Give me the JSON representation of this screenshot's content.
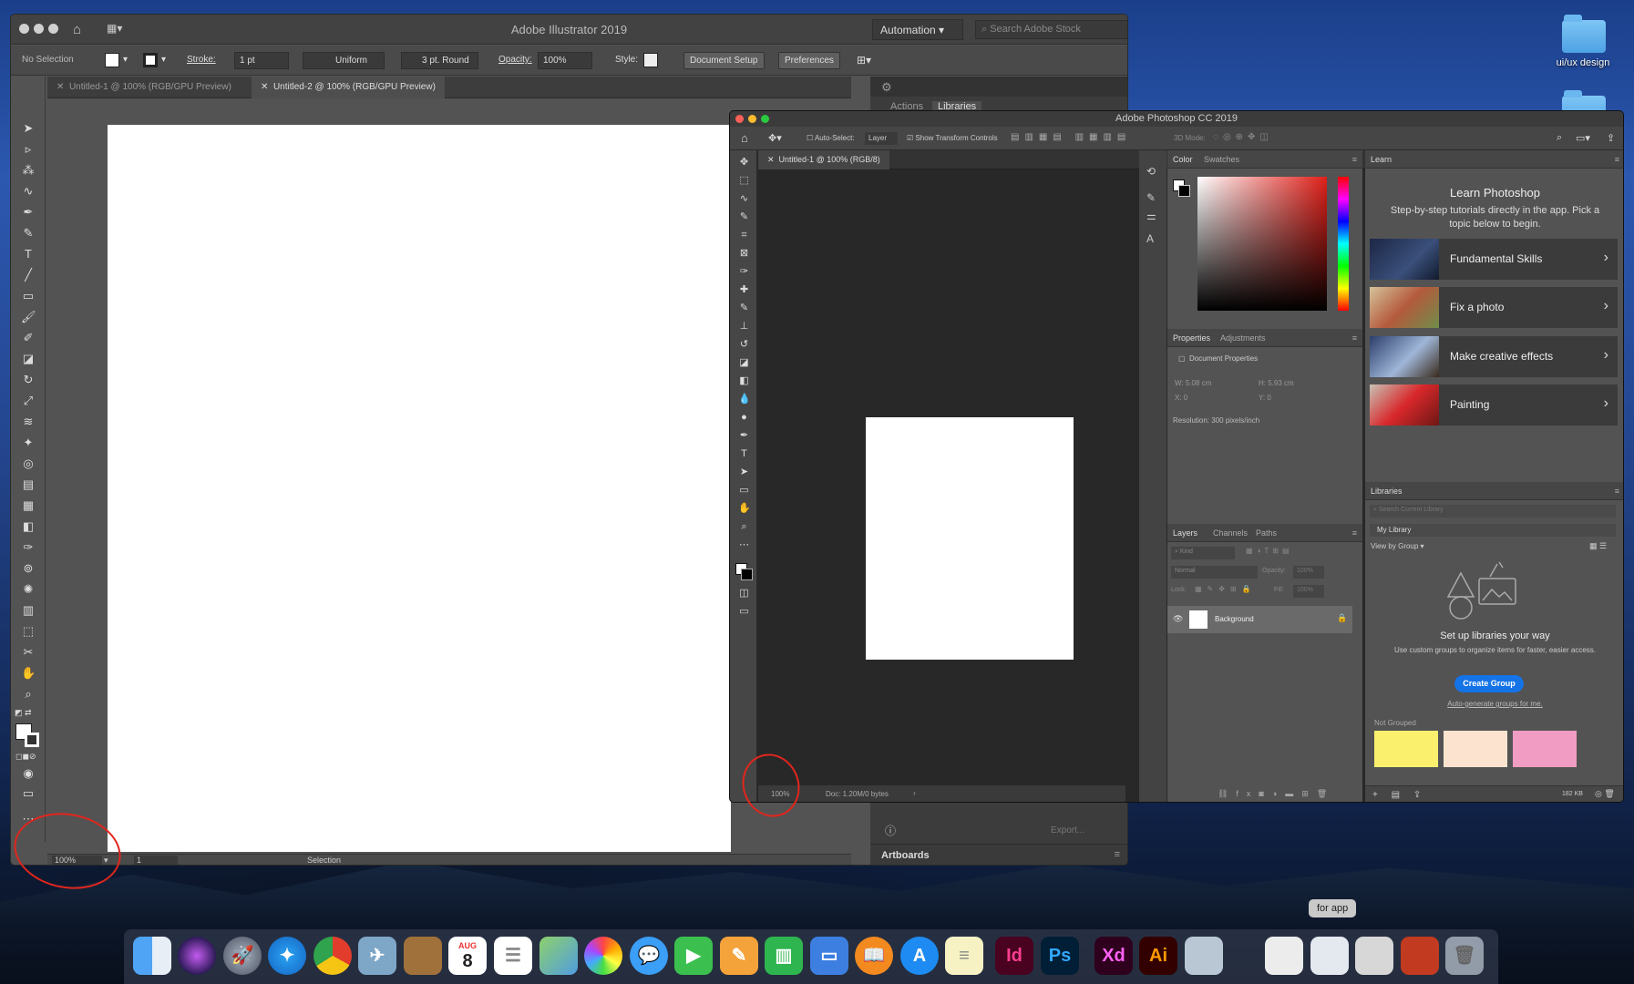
{
  "desktop": {
    "folder_label": "ui/ux design",
    "tooltip": "for app"
  },
  "illustrator": {
    "title": "Adobe Illustrator 2019",
    "workspace": "Automation",
    "search_placeholder": "Search Adobe Stock",
    "selection_text": "No Selection",
    "stroke_label": "Stroke:",
    "stroke_value": "1 pt",
    "profile": "Uniform",
    "brush": "3 pt. Round",
    "opacity_label": "Opacity:",
    "opacity_value": "100%",
    "style_label": "Style:",
    "document_setup": "Document Setup",
    "preferences": "Preferences",
    "tabs": [
      "Untitled-1 @ 100% (RGB/GPU Preview)",
      "Untitled-2 @ 100% (RGB/GPU Preview)"
    ],
    "zoom": "100%",
    "artboard_num": "1",
    "status_tool": "Selection",
    "panel_tabs": [
      "Actions",
      "Libraries"
    ],
    "export_label": "Export...",
    "artboards_label": "Artboards"
  },
  "photoshop": {
    "title": "Adobe Photoshop CC 2019",
    "auto_select": "Auto-Select:",
    "layer_select": "Layer",
    "transform": "Show Transform Controls",
    "mode3d": "3D Mode:",
    "doc_tab": "Untitled-1 @ 100% (RGB/8)",
    "zoom": "100%",
    "doc_size": "Doc: 1.20M/0 bytes",
    "color_tabs": [
      "Color",
      "Swatches"
    ],
    "prop_tabs": [
      "Properties",
      "Adjustments"
    ],
    "doc_props": "Document Properties",
    "w": "W: 5.08 cm",
    "h": "H: 5.93 cm",
    "x": "X: 0",
    "y": "Y: 0",
    "resolution": "Resolution: 300 pixels/inch",
    "layer_tabs": [
      "Layers",
      "Channels",
      "Paths"
    ],
    "kind": "Kind",
    "blend": "Normal",
    "opacity_label": "Opacity:",
    "opacity_value": "100%",
    "lock_label": "Lock:",
    "fill_label": "Fill:",
    "fill_value": "100%",
    "layer_name": "Background",
    "learn": {
      "tab": "Learn",
      "title": "Learn Photoshop",
      "subtitle": "Step-by-step tutorials directly in the app. Pick a topic below to begin.",
      "items": [
        "Fundamental Skills",
        "Fix a photo",
        "Make creative effects",
        "Painting"
      ]
    },
    "libraries": {
      "tab": "Libraries",
      "search_placeholder": "Search Current Library",
      "library": "My Library",
      "view": "View by Group",
      "heading": "Set up libraries your way",
      "desc": "Use custom groups to organize items for faster, easier access.",
      "create": "Create Group",
      "auto": "Auto-generate groups for me.",
      "not_grouped": "Not Grouped",
      "size": "182 KB",
      "swatches": [
        "#fbf06d",
        "#fbe3cf",
        "#f19cc3"
      ]
    }
  },
  "dock": {
    "apps": [
      "Finder",
      "Siri",
      "Launchpad",
      "Safari",
      "Chrome",
      "Preview",
      "Notes",
      "Calendar",
      "Reminders",
      "Maps",
      "Photos",
      "Messages",
      "FaceTime",
      "Pages",
      "Numbers",
      "Keynote",
      "Books",
      "App Store",
      "Notes2",
      "InDesign",
      "Photoshop",
      "XD",
      "Illustrator",
      "Preview2"
    ],
    "calendar_month": "AUG",
    "calendar_day": "8",
    "id_label": "Id",
    "ps_label": "Ps",
    "xd_label": "Xd",
    "ai_label": "Ai"
  }
}
